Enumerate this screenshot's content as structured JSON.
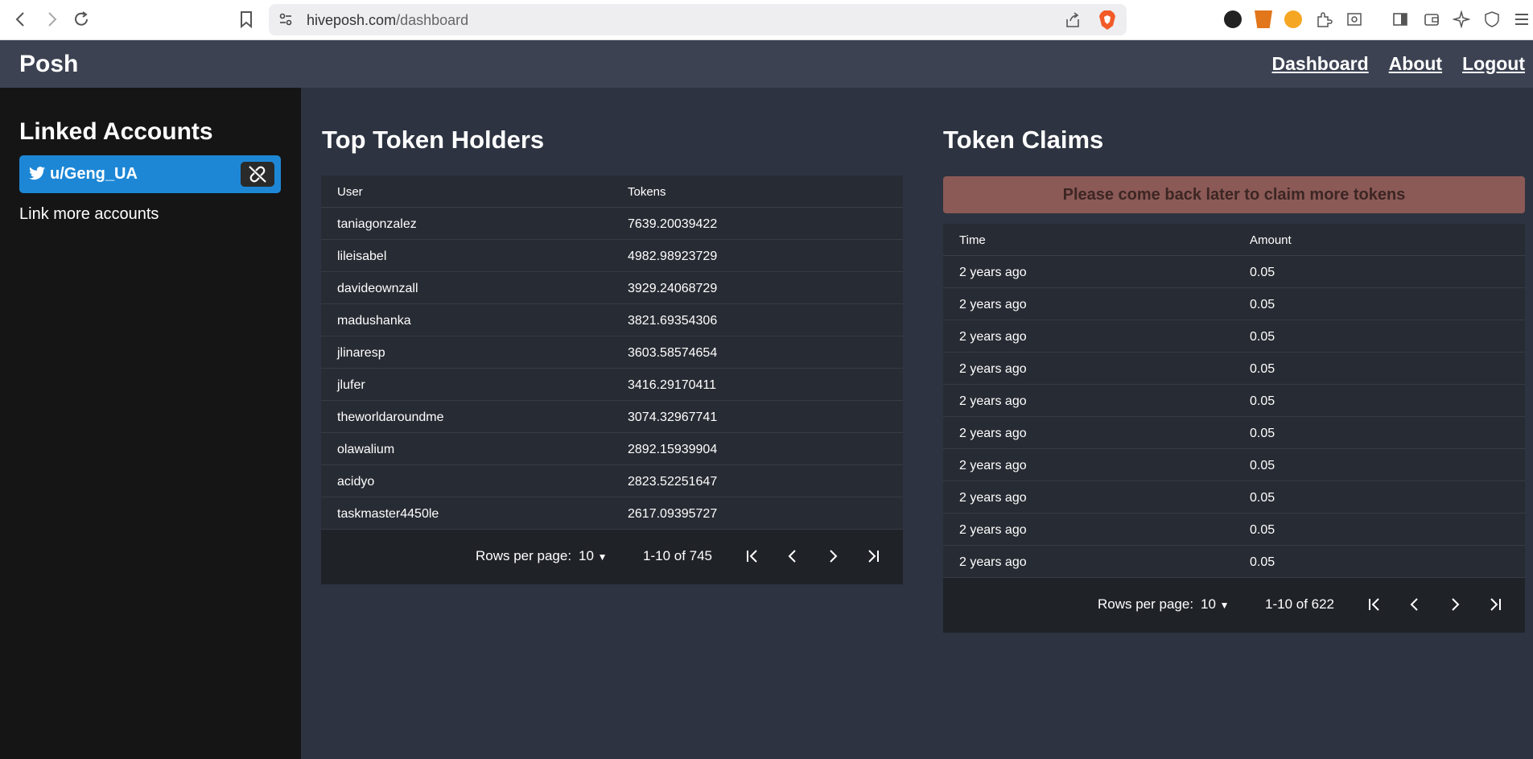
{
  "browser": {
    "url_host": "hiveposh.com",
    "url_path": "/dashboard"
  },
  "header": {
    "brand": "Posh",
    "links": [
      "Dashboard",
      "About",
      "Logout"
    ]
  },
  "sidebar": {
    "title": "Linked Accounts",
    "account": "u/Geng_UA",
    "link_more": "Link more accounts"
  },
  "holders": {
    "title": "Top Token Holders",
    "columns": [
      "User",
      "Tokens"
    ],
    "rows": [
      [
        "taniagonzalez",
        "7639.20039422"
      ],
      [
        "lileisabel",
        "4982.98923729"
      ],
      [
        "davideownzall",
        "3929.24068729"
      ],
      [
        "madushanka",
        "3821.69354306"
      ],
      [
        "jlinaresp",
        "3603.58574654"
      ],
      [
        "jlufer",
        "3416.29170411"
      ],
      [
        "theworldaroundme",
        "3074.32967741"
      ],
      [
        "olawalium",
        "2892.15939904"
      ],
      [
        "acidyo",
        "2823.52251647"
      ],
      [
        "taskmaster4450le",
        "2617.09395727"
      ]
    ],
    "rows_per_page_label": "Rows per page:",
    "rows_per_page": "10",
    "range": "1-10 of 745"
  },
  "claims": {
    "title": "Token Claims",
    "banner": "Please come back later to claim more tokens",
    "columns": [
      "Time",
      "Amount"
    ],
    "rows": [
      [
        "2 years ago",
        "0.05"
      ],
      [
        "2 years ago",
        "0.05"
      ],
      [
        "2 years ago",
        "0.05"
      ],
      [
        "2 years ago",
        "0.05"
      ],
      [
        "2 years ago",
        "0.05"
      ],
      [
        "2 years ago",
        "0.05"
      ],
      [
        "2 years ago",
        "0.05"
      ],
      [
        "2 years ago",
        "0.05"
      ],
      [
        "2 years ago",
        "0.05"
      ],
      [
        "2 years ago",
        "0.05"
      ]
    ],
    "rows_per_page_label": "Rows per page:",
    "rows_per_page": "10",
    "range": "1-10 of 622"
  }
}
